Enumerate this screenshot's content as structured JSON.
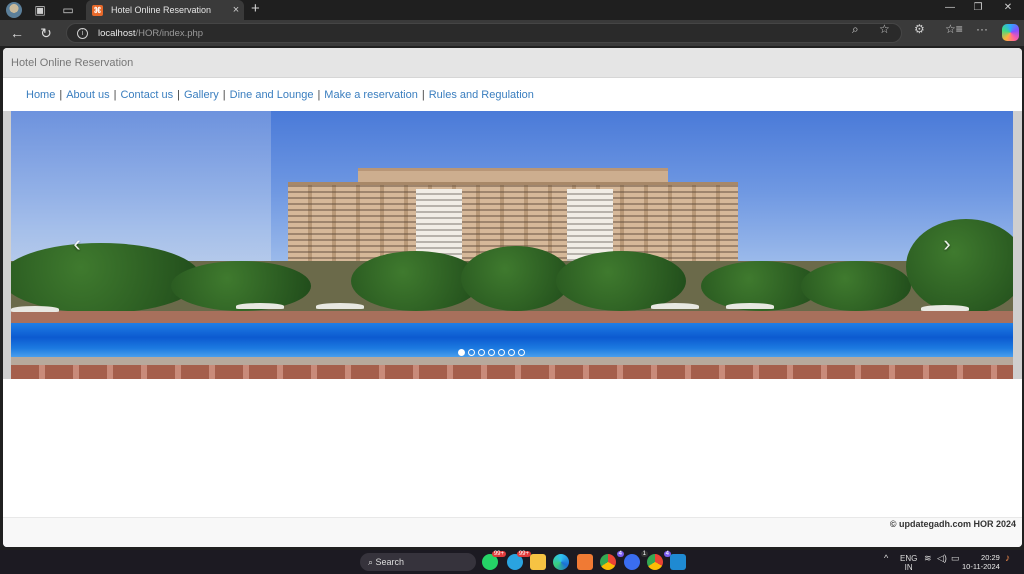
{
  "browser": {
    "tab_title": "Hotel Online Reservation",
    "url_host": "localhost",
    "url_path": "/HOR/index.php",
    "icons": {
      "profile": "profile-avatar",
      "workspaces": "workspaces-icon",
      "tab_actions": "tab-actions-icon",
      "close_tab": "×",
      "new_tab": "+",
      "back": "←",
      "reload": "↻",
      "info": "i",
      "zoom": "⌕",
      "favorite": "☆",
      "extensions": "⚙",
      "favorites": "☆≡",
      "more": "···",
      "minimize": "—",
      "restore": "❐",
      "close": "✕"
    }
  },
  "site": {
    "header_title": "Hotel Online Reservation",
    "menu": [
      {
        "label": "Home"
      },
      {
        "label": "About us"
      },
      {
        "label": "Contact us"
      },
      {
        "label": "Gallery"
      },
      {
        "label": "Dine and Lounge"
      },
      {
        "label": "Make a reservation"
      },
      {
        "label": "Rules and Regulation"
      }
    ],
    "menu_separator": "|",
    "carousel": {
      "prev_glyph": "‹",
      "next_glyph": "›",
      "slide_count": 7,
      "active_index": 0,
      "slide_description": "Hotel building with swimming pool"
    },
    "footer_text": "© updategadh.com HOR 2024"
  },
  "taskbar": {
    "search_label": "Search",
    "whatsapp_badge": "99+",
    "telegram_badge": "99+",
    "chrome_badge_1": "4",
    "app_badge": "1",
    "chrome_badge_2": "4",
    "language_top": "ENG",
    "language_bottom": "IN",
    "time": "20:29",
    "date": "10-11-2024",
    "tray_chevron": "^"
  }
}
